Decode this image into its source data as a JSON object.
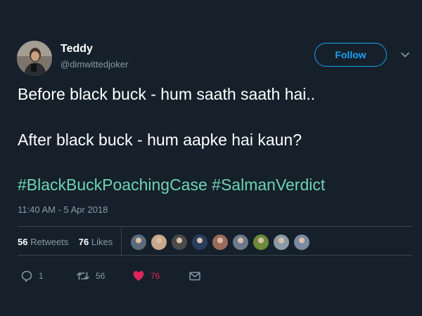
{
  "user": {
    "name": "Teddy",
    "handle": "@dimwittedjoker"
  },
  "follow_button": {
    "label": "Follow"
  },
  "tweet": {
    "lines": [
      "Before black buck - hum saath saath hai..",
      "After black buck - hum aapke hai kaun?"
    ],
    "hashtags": [
      "#BlackBuckPoachingCase",
      "#SalmanVerdict"
    ],
    "timestamp": "11:40 AM - 5 Apr 2018"
  },
  "stats": {
    "retweets_count": "56",
    "retweets_label": "Retweets",
    "likes_count": "76",
    "likes_label": "Likes"
  },
  "liker_avatar_colors": [
    "#5b6b7a",
    "#c9a78a",
    "#4a4a4a",
    "#2a3d5c",
    "#9a6a5a",
    "#6a7a8a",
    "#6b8a3a",
    "#8a9aa6",
    "#7a8aa0"
  ],
  "actions": {
    "replies": "1",
    "retweets": "56",
    "likes": "76"
  },
  "colors": {
    "background": "#15202b",
    "accent": "#1da1f2",
    "hashtag": "#6fd3b3",
    "like": "#e0245e",
    "muted": "#8899a6"
  },
  "icons": [
    "reply-icon",
    "retweet-icon",
    "heart-icon",
    "message-icon",
    "chevron-down-icon"
  ]
}
